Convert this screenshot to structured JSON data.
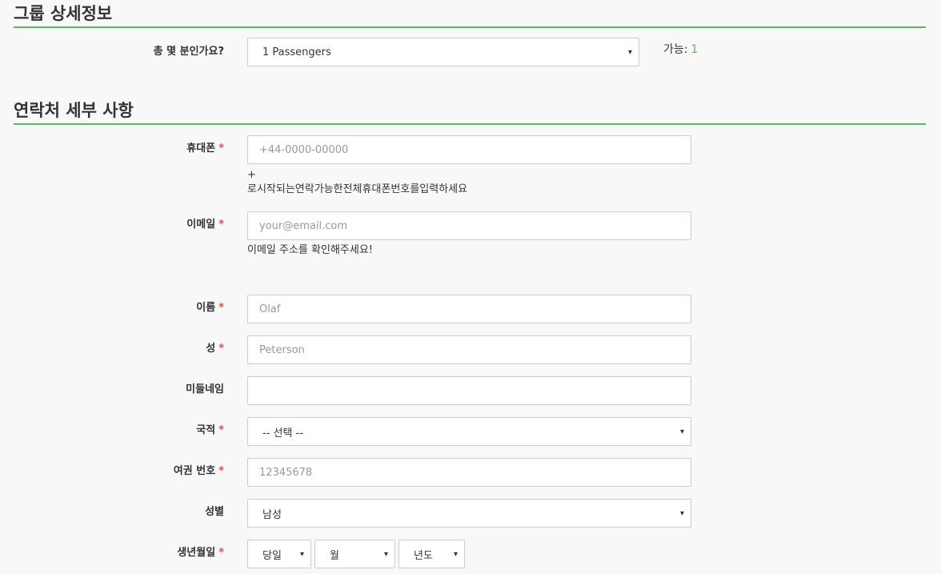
{
  "group": {
    "title": "그룹 상세정보",
    "passengers_label": "총 몇 분인가요?",
    "passengers_value": "1 Passengers",
    "available_label": "가능:",
    "available_count": "1"
  },
  "contact": {
    "title": "연락처 세부 사항",
    "required_mark": "*",
    "phone": {
      "label": "휴대폰",
      "placeholder": "+44-0000-00000",
      "help_line1": "+",
      "help_line2": "로시작되는연락가능한전체휴대폰번호를입력하세요"
    },
    "email": {
      "label": "이메일",
      "placeholder": "your@email.com",
      "help": "이메일 주소를 확인해주세요!"
    },
    "first_name": {
      "label": "이름",
      "placeholder": "Olaf"
    },
    "last_name": {
      "label": "성",
      "placeholder": "Peterson"
    },
    "middle_name": {
      "label": "미들네임",
      "placeholder": ""
    },
    "nationality": {
      "label": "국적",
      "value": "-- 선택 --"
    },
    "passport": {
      "label": "여권 번호",
      "placeholder": "12345678"
    },
    "gender": {
      "label": "성별",
      "value": "남성"
    },
    "birthdate": {
      "label": "생년월일",
      "day": "당일",
      "month": "월",
      "year": "년도"
    }
  },
  "icons": {
    "dropdown_caret": "▾"
  },
  "colors": {
    "accent": "#5cb85c",
    "required": "#d9534f"
  }
}
